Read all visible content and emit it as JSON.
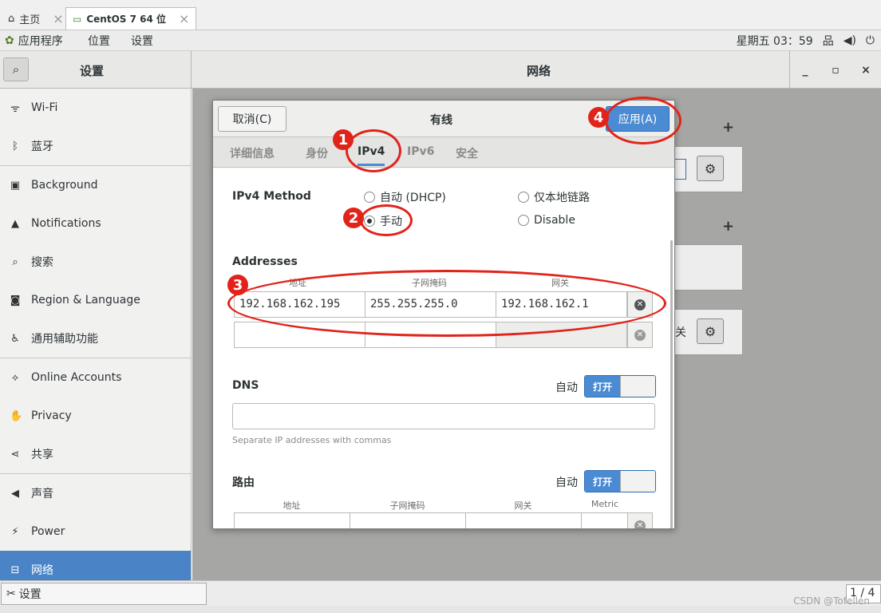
{
  "browser_tabs": [
    {
      "label": "主页",
      "active": false
    },
    {
      "label": "CentOS 7 64 位",
      "active": true
    }
  ],
  "topbar": {
    "applications": "应用程序",
    "places": "位置",
    "settings": "设置",
    "clock": "星期五 03：59"
  },
  "settings_header": {
    "title": "设置"
  },
  "network_header": {
    "title": "网络"
  },
  "sidebar": {
    "items": [
      {
        "label": "Wi-Fi",
        "icon": "wifi-icon",
        "glyph": "ᯤ"
      },
      {
        "label": "蓝牙",
        "icon": "bluetooth-icon",
        "glyph": "ᛒ"
      },
      {
        "label": "Background",
        "icon": "display-icon",
        "glyph": "▣"
      },
      {
        "label": "Notifications",
        "icon": "bell-icon",
        "glyph": "▲"
      },
      {
        "label": "搜索",
        "icon": "search-icon",
        "glyph": "⌕"
      },
      {
        "label": "Region & Language",
        "icon": "camera-icon",
        "glyph": "◙"
      },
      {
        "label": "通用辅助功能",
        "icon": "accessibility-icon",
        "glyph": "♿"
      },
      {
        "label": "Online Accounts",
        "icon": "accounts-icon",
        "glyph": "⟡"
      },
      {
        "label": "Privacy",
        "icon": "hand-icon",
        "glyph": "✋"
      },
      {
        "label": "共享",
        "icon": "share-icon",
        "glyph": "⋖"
      },
      {
        "label": "声音",
        "icon": "speaker-icon",
        "glyph": "◀"
      },
      {
        "label": "Power",
        "icon": "power-icon",
        "glyph": "⚡"
      },
      {
        "label": "网络",
        "icon": "network-icon",
        "glyph": "⊟",
        "selected": true
      }
    ]
  },
  "dialog": {
    "cancel": "取消(C)",
    "title": "有线",
    "apply": "应用(A)",
    "tabs": [
      "详细信息",
      "身份",
      "IPv4",
      "IPv6",
      "安全"
    ],
    "active_tab": "IPv4",
    "ipv4_method_label": "IPv4 Method",
    "methods": {
      "auto_dhcp": "自动 (DHCP)",
      "link_local": "仅本地链路",
      "manual": "手动",
      "disable": "Disable"
    },
    "selected_method": "手动",
    "addresses_label": "Addresses",
    "address_cols": [
      "地址",
      "子网掩码",
      "网关"
    ],
    "address_row": {
      "address": "192.168.162.195",
      "netmask": "255.255.255.0",
      "gateway": "192.168.162.1"
    },
    "dns_label": "DNS",
    "dns_auto": "自动",
    "dns_switch": "打开",
    "dns_hint": "Separate IP addresses with commas",
    "routes_label": "路由",
    "routes_auto": "自动",
    "routes_switch": "打开",
    "route_cols": [
      "地址",
      "子网掩码",
      "网关",
      "Metric"
    ]
  },
  "annotations": [
    "1",
    "2",
    "3",
    "4"
  ],
  "background_partial_text": "关",
  "taskbar": {
    "task": "设置",
    "pager": "1 / 4"
  },
  "watermark": "CSDN @Tofellen"
}
